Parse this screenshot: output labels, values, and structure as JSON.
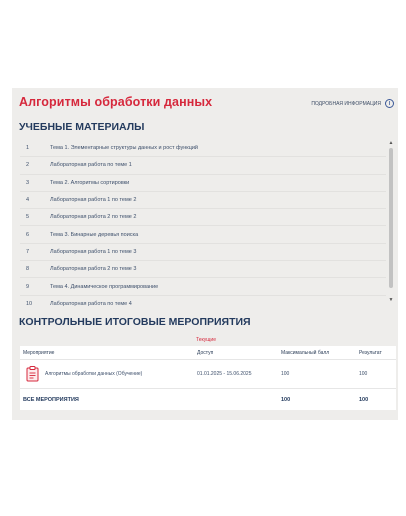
{
  "header": {
    "title": "Алгоритмы обработки данных",
    "info_link": "ПОДРОБНАЯ ИНФОРМАЦИЯ",
    "info_icon": "info-icon"
  },
  "materials": {
    "heading": "УЧЕБНЫЕ МАТЕРИАЛЫ",
    "items": [
      {
        "num": "1",
        "title": "Тема 1. Элементарные структуры данных и рост функций"
      },
      {
        "num": "2",
        "title": "Лабораторная работа по теме 1"
      },
      {
        "num": "3",
        "title": "Тема 2. Алгоритмы сортировки"
      },
      {
        "num": "4",
        "title": "Лабораторная работа 1 по теме 2"
      },
      {
        "num": "5",
        "title": "Лабораторная работа 2 по теме 2"
      },
      {
        "num": "6",
        "title": "Тема 3. Бинарные деревья поиска"
      },
      {
        "num": "7",
        "title": "Лабораторная работа 1 по теме 3"
      },
      {
        "num": "8",
        "title": "Лабораторная работа 2 по теме 3"
      },
      {
        "num": "9",
        "title": "Тема 4. Динамическое программирование"
      },
      {
        "num": "10",
        "title": "Лабораторная работа по теме 4"
      }
    ]
  },
  "control": {
    "heading": "КОНТРОЛЬНЫЕ ИТОГОВЫЕ МЕРОПРИЯТИЯ",
    "current_tab": "Текущие",
    "columns": [
      "Мероприятие",
      "Доступ",
      "Максимальный балл",
      "Результат"
    ],
    "rows": [
      {
        "name": "Алгоритмы обработки данных (Обучение)",
        "access": "01.01.2025 - 15.06.2025",
        "max": "100",
        "result": "100",
        "icon": "clipboard-icon"
      }
    ],
    "total": {
      "label": "ВСЕ МЕРОПРИЯТИЯ",
      "max": "100",
      "result": "100"
    }
  },
  "colors": {
    "accent": "#d6283c",
    "heading": "#243b5e",
    "panel": "#eeedeb"
  }
}
